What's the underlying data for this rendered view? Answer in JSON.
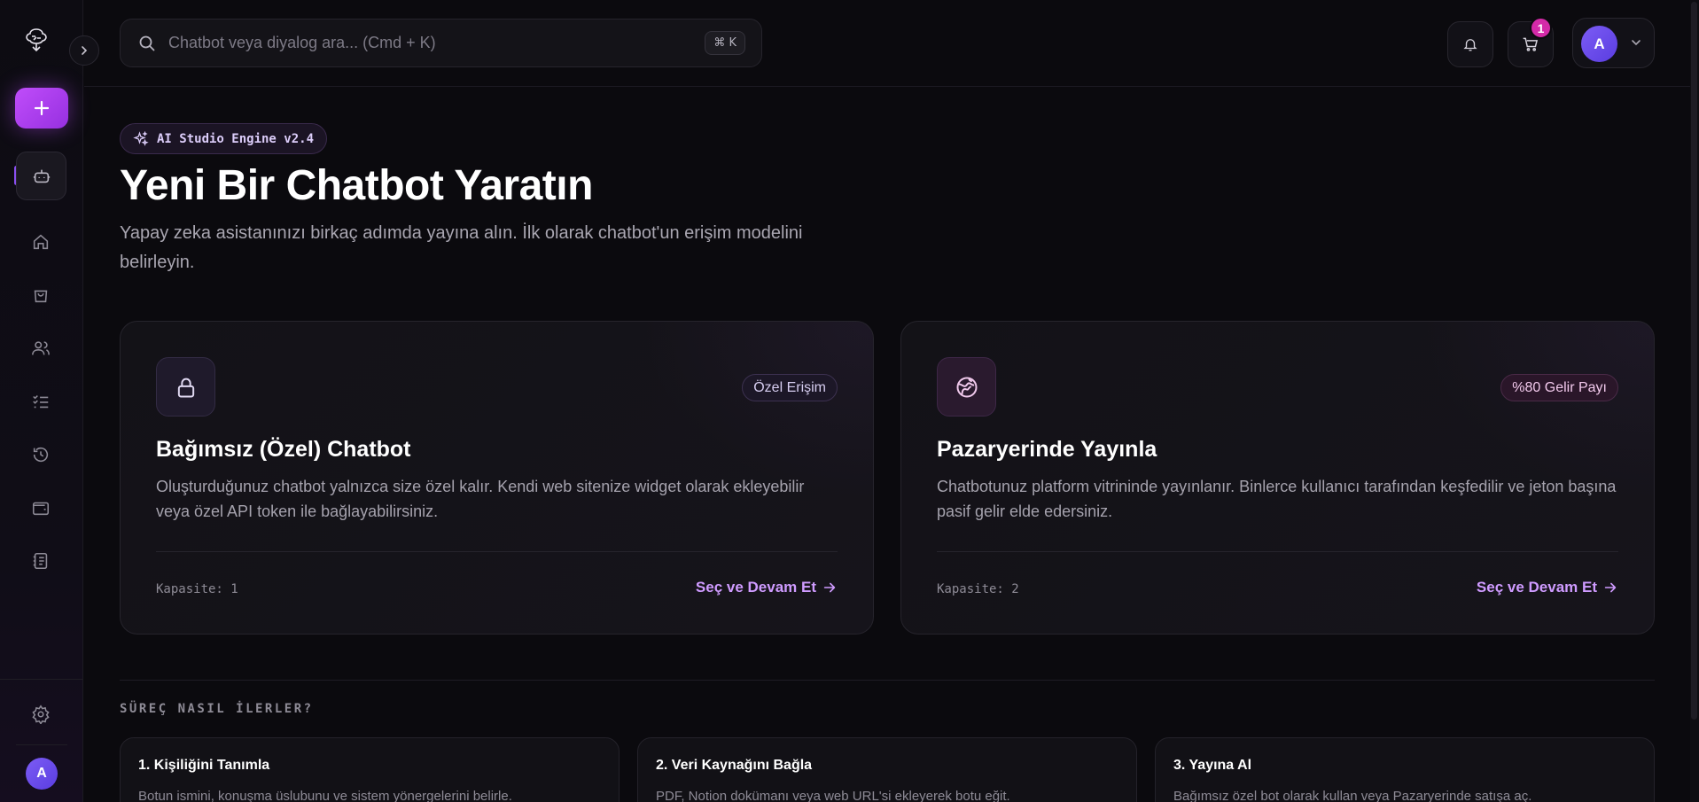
{
  "colors": {
    "accent": "#b043f2",
    "accent_link": "#cf9bff",
    "badge_cart": "#d42aa8",
    "avatar": "#6d4ef0",
    "background": "#0b0a0e"
  },
  "sidebar": {
    "logo_icon": "brain-tree-logo-icon",
    "collapse_icon": "chevron-right-icon",
    "new_icon": "plus-icon",
    "active_icon": "bot-icon",
    "items": [
      {
        "icon": "home-icon",
        "name": "home"
      },
      {
        "icon": "shopping-bag-icon",
        "name": "marketplace"
      },
      {
        "icon": "users-icon",
        "name": "users"
      },
      {
        "icon": "checklist-icon",
        "name": "tasks"
      },
      {
        "icon": "history-icon",
        "name": "history"
      },
      {
        "icon": "wallet-icon",
        "name": "wallet"
      },
      {
        "icon": "notebook-icon",
        "name": "docs"
      }
    ],
    "settings_icon": "gear-icon",
    "avatar_initial": "A"
  },
  "header": {
    "search_placeholder": "Chatbot veya diyalog ara... (Cmd + K)",
    "shortcut": "⌘ K",
    "notification_icon": "bell-icon",
    "cart_icon": "cart-icon",
    "cart_count": "1",
    "user_initial": "A"
  },
  "hero": {
    "engine_badge": "AI Studio Engine v2.4",
    "title": "Yeni Bir Chatbot Yaratın",
    "subtitle": "Yapay zeka asistanınızı birkaç adımda yayına alın. İlk olarak chatbot'un erişim modelini belirleyin."
  },
  "cards": [
    {
      "icon": "lock-icon",
      "tag": "Özel Erişim",
      "title": "Bağımsız (Özel) Chatbot",
      "description": "Oluşturduğunuz chatbot yalnızca size özel kalır. Kendi web sitenize widget olarak ekleyebilir veya özel API token ile bağlayabilirsiniz.",
      "capacity": "Kapasite: 1",
      "cta": "Seç ve Devam Et"
    },
    {
      "icon": "globe-icon",
      "tag": "%80 Gelir Payı",
      "title": "Pazaryerinde Yayınla",
      "description": "Chatbotunuz platform vitrininde yayınlanır. Binlerce kullanıcı tarafından keşfedilir ve jeton başına pasif gelir elde edersiniz.",
      "capacity": "Kapasite: 2",
      "cta": "Seç ve Devam Et"
    }
  ],
  "process": {
    "title": "SÜREÇ NASIL İLERLER?",
    "steps": [
      {
        "title": "1. Kişiliğini Tanımla",
        "description": "Botun ismini, konuşma üslubunu ve sistem yönergelerini belirle."
      },
      {
        "title": "2. Veri Kaynağını Bağla",
        "description": "PDF, Notion dokümanı veya web URL'si ekleyerek botu eğit."
      },
      {
        "title": "3. Yayına Al",
        "description": "Bağımsız özel bot olarak kullan veya Pazaryerinde satışa aç."
      }
    ]
  }
}
